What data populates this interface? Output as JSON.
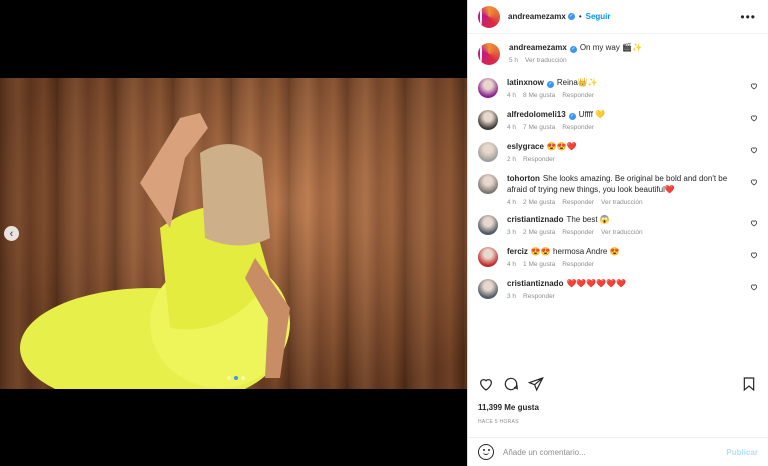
{
  "post": {
    "username": "andreamezamx",
    "follow_label": "Seguir",
    "separator": "•",
    "more_label": "•••",
    "nav_prev": "‹",
    "caption": {
      "username": "andreamezamx",
      "text": "On my way 🎬✨",
      "time": "5 h",
      "translate": "Ver traducción"
    },
    "likes": "11,399 Me gusta",
    "ago": "HACE 5 HORAS"
  },
  "comments": [
    {
      "username": "latinxnow",
      "verified": true,
      "text": "Reina👑✨",
      "time": "4 h",
      "likes": "8 Me gusta",
      "reply": "Responder",
      "translate": "",
      "avatar_color": "#8a1f8f"
    },
    {
      "username": "alfredolomeli13",
      "verified": true,
      "text": "Uffff 💛",
      "time": "4 h",
      "likes": "7 Me gusta",
      "reply": "Responder",
      "translate": "",
      "avatar_color": "#3d3a36"
    },
    {
      "username": "eslygrace",
      "verified": false,
      "text": "😍😍❤️",
      "time": "2 h",
      "likes": "",
      "reply": "Responder",
      "translate": "",
      "avatar_color": "#9f9f9f"
    },
    {
      "username": "tohorton",
      "verified": false,
      "text": "She looks amazing. Be original be bold and don't be afraid of trying new things, you look beautiful❤️",
      "time": "4 h",
      "likes": "2 Me gusta",
      "reply": "Responder",
      "translate": "Ver traducción",
      "avatar_color": "#7d7570"
    },
    {
      "username": "cristiantiznado",
      "verified": false,
      "text": "The best 😱",
      "time": "3 h",
      "likes": "2 Me gusta",
      "reply": "Responder",
      "translate": "Ver traducción",
      "avatar_color": "#4e5b68"
    },
    {
      "username": "ferciz",
      "verified": false,
      "text": "😍😍 hermosa Andre 😍",
      "time": "4 h",
      "likes": "1 Me gusta",
      "reply": "Responder",
      "translate": "",
      "avatar_color": "#c12a2a"
    },
    {
      "username": "cristiantiznado",
      "verified": false,
      "text": "❤️❤️❤️❤️❤️❤️",
      "time": "3 h",
      "likes": "",
      "reply": "Responder",
      "translate": "",
      "avatar_color": "#4e5b68"
    }
  ],
  "add_comment": {
    "placeholder": "Añade un comentario...",
    "publish": "Publicar"
  },
  "icons": {
    "like": "heart-icon",
    "comment": "comment-icon",
    "share": "paper-plane-icon",
    "save": "bookmark-icon",
    "emoji": "emoji-icon",
    "comment_like": "heart-icon"
  },
  "colors": {
    "accent": "#0095f6",
    "verified": "#3897f0",
    "publish_disabled": "#b2dffc"
  }
}
